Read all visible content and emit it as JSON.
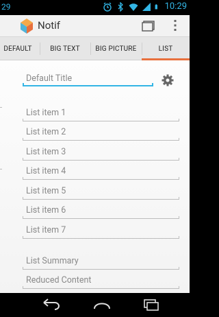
{
  "status_bar": {
    "left_text": "29",
    "time": "10:29",
    "icons": [
      "alarm-icon",
      "bluetooth-icon",
      "wifi-icon",
      "signal-icon",
      "battery-icon"
    ],
    "color": "#33b5e5"
  },
  "action_bar": {
    "title": "Notif",
    "icons": [
      "app-logo-icon",
      "folder-icon",
      "overflow-menu-icon"
    ]
  },
  "tabs": [
    {
      "label": "DEFAULT",
      "selected": false
    },
    {
      "label": "BIG TEXT",
      "selected": false
    },
    {
      "label": "BIG PICTURE",
      "selected": false
    },
    {
      "label": "LIST",
      "selected": true
    }
  ],
  "accent_color": "#e8703d",
  "form": {
    "title_placeholder": "Default Title",
    "settings_icon": "gear-icon",
    "list_items": [
      "List item 1",
      "List item 2",
      "List item 3",
      "List item 4",
      "List item 5",
      "List item 6",
      "List item 7"
    ],
    "summary_placeholder": "List Summary",
    "reduced_content_placeholder": "Reduced Content"
  },
  "nav_bar": {
    "icons": [
      "back-icon",
      "home-icon",
      "recent-apps-icon"
    ]
  }
}
